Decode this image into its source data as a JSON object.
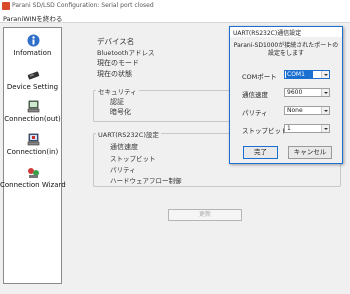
{
  "window": {
    "title": "Parani SD/LSD Configuration: Serial port closed"
  },
  "menu": {
    "items": [
      "ParaniWINを終わる"
    ]
  },
  "sidebar": {
    "items": [
      {
        "label": "Infomation",
        "icon": "info-icon"
      },
      {
        "label": "Device Setting",
        "icon": "device-icon"
      },
      {
        "label": "Connection(out)",
        "icon": "connection-out-icon"
      },
      {
        "label": "Connection(in)",
        "icon": "connection-in-icon"
      },
      {
        "label": "Connection Wizard",
        "icon": "wizard-icon"
      }
    ]
  },
  "main": {
    "device_name_label": "デバイス名",
    "bt_address_label": "Bluetoothアドレス",
    "current_mode_label": "現在のモード",
    "current_state_label": "現在の状態",
    "security": {
      "title": "セキュリティ",
      "auth_label": "認証",
      "encrypt_label": "暗号化"
    },
    "uart": {
      "title": "UART(RS232C)設定",
      "baud_label": "通信速度",
      "stopbit_label": "ストップビット",
      "parity_label": "パリティ",
      "flow_label": "ハードウェアフロー制御"
    },
    "update_button": "更新"
  },
  "dialog": {
    "title": "UART(RS232C)通信設定",
    "description_line1": "Parani-SD1000が接続されたポートの",
    "description_line2": "設定をします",
    "com_port_label": "COMポート",
    "com_port_value": "COM1",
    "baud_label": "通信速度",
    "baud_value": "9600",
    "parity_label": "パリティ",
    "parity_value": "None",
    "stopbit_label": "ストップビット",
    "stopbit_value": "1",
    "ok_button": "完了",
    "cancel_button": "キャンセル"
  }
}
